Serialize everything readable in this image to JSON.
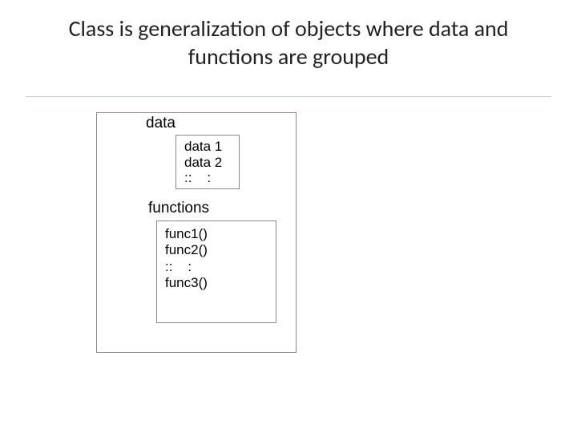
{
  "title": "Class is generalization of objects where data and functions are grouped",
  "diagram": {
    "data_label": "data",
    "functions_label": "functions",
    "data_items": "data 1\ndata 2\n::    :",
    "function_items": "func1()\nfunc2()\n::    :\nfunc3()"
  }
}
